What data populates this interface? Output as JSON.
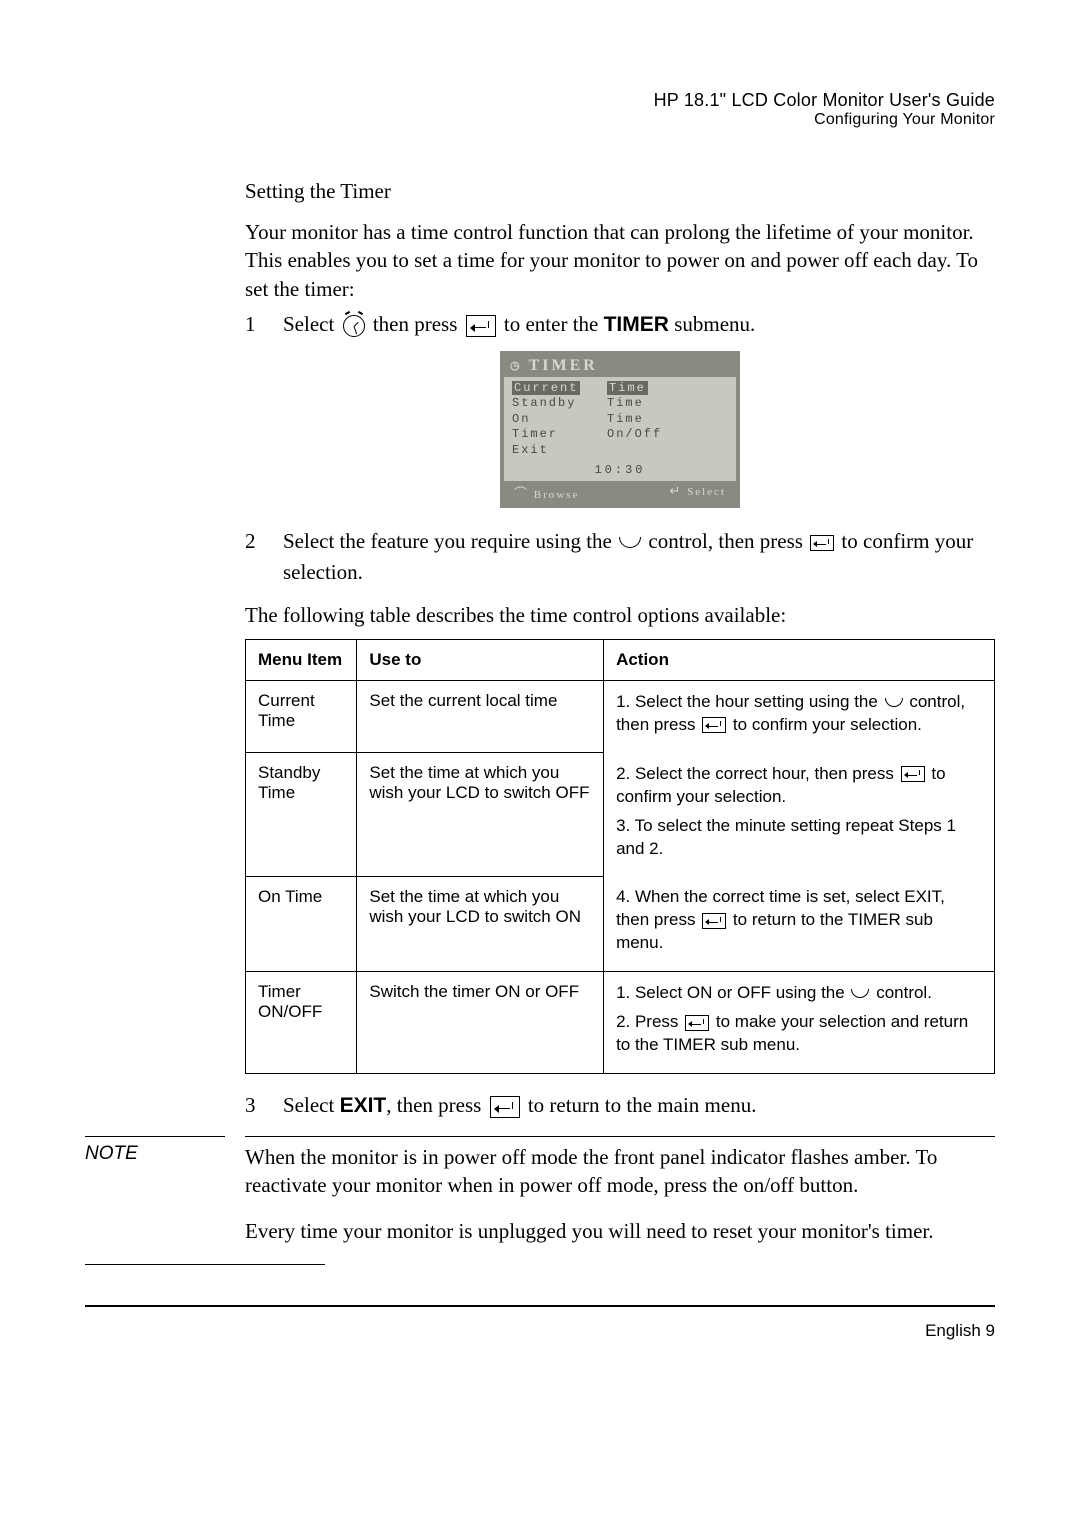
{
  "header": {
    "title": "HP 18.1\" LCD Color Monitor User's Guide",
    "subtitle": "Configuring Your Monitor"
  },
  "section_heading": "Setting the Timer",
  "intro": "Your monitor has a time control function that can prolong the lifetime of your monitor. This enables you to set a time for your monitor to power on and power off each day. To set the timer:",
  "step1": {
    "num": "1",
    "a": "Select",
    "b": "then press",
    "c": "to enter the",
    "d": "TIMER",
    "e": "submenu."
  },
  "menu": {
    "title": "TIMER",
    "rows": [
      {
        "col1": "Current",
        "col2": "Time",
        "hl": true
      },
      {
        "col1": "Standby",
        "col2": "Time",
        "hl": false
      },
      {
        "col1": "On",
        "col2": "Time",
        "hl": false
      },
      {
        "col1": "Timer",
        "col2": "On/Off",
        "hl": false
      },
      {
        "col1": "Exit",
        "col2": "",
        "hl": false
      }
    ],
    "clock": "10:30",
    "footer_left": "Browse",
    "footer_right": "Select"
  },
  "step2": {
    "num": "2",
    "a": "Select the feature you require using the",
    "b": "control, then press",
    "c": "to confirm your selection."
  },
  "table_intro": "The following table describes the time control options available:",
  "table": {
    "headers": [
      "Menu Item",
      "Use to",
      "Action"
    ],
    "rows": [
      {
        "item": "Current Time",
        "use": "Set the current local time",
        "action_a": "1. Select the hour setting using the",
        "action_b": "control, then press",
        "action_c": "to confirm your selection."
      },
      {
        "item": "Standby Time",
        "use": "Set the time at which you wish your LCD to switch OFF",
        "action_a": "2. Select the correct hour, then press",
        "action_b": "to confirm your selection.",
        "action_c": "3. To select the minute setting repeat Steps 1 and 2."
      },
      {
        "item": "On Time",
        "use": "Set the time at which you wish your LCD to switch ON",
        "action_a": "4. When the correct time is set, select EXIT, then press",
        "action_b": "to return to the TIMER sub menu."
      },
      {
        "item": "Timer ON/OFF",
        "use": "Switch the timer ON or OFF",
        "action_a": "1. Select ON or OFF using the",
        "action_b": "control.",
        "action_c": "2. Press",
        "action_d": "to make your selection and return to the TIMER sub menu."
      }
    ]
  },
  "step3": {
    "num": "3",
    "a": "Select",
    "b": "EXIT",
    "c": ", then press",
    "d": "to return to the main menu."
  },
  "note_label": "NOTE",
  "note_p1": "When the monitor is in power off mode the front panel indicator flashes amber. To reactivate your monitor when in power off mode, press the on/off button.",
  "note_p2": "Every time your monitor is unplugged you will need to reset your monitor's timer.",
  "footer": "English  9"
}
